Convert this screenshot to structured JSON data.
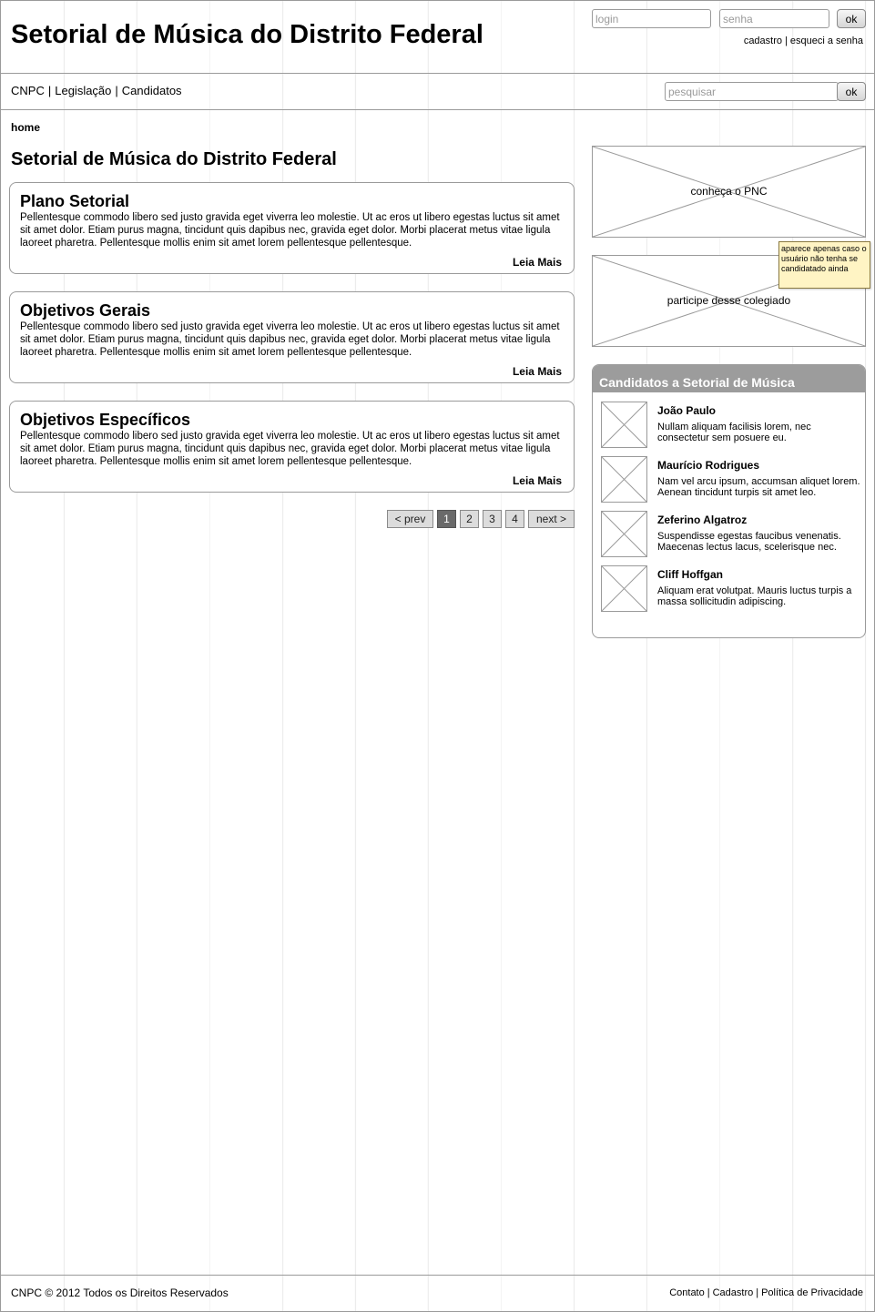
{
  "header": {
    "site_title": "Setorial de Música do Distrito Federal",
    "login_placeholder": "login",
    "password_placeholder": "senha",
    "login_button": "ok",
    "links": [
      "cadastro",
      "esqueci a senha"
    ],
    "separator": "|"
  },
  "nav": {
    "items": [
      "CNPC",
      "Legislação",
      "Candidatos"
    ],
    "separator": "|",
    "search_placeholder": "pesquisar",
    "search_button": "ok"
  },
  "breadcrumb": "home",
  "page_title": "Setorial de Música do Distrito Federal",
  "sections": [
    {
      "title": "Plano Setorial",
      "body": "Pellentesque commodo libero sed justo gravida eget viverra leo molestie. Ut ac eros ut libero egestas luctus sit amet sit amet dolor. Etiam purus magna, tincidunt quis dapibus nec, gravida eget dolor. Morbi placerat metus vitae ligula laoreet pharetra. Pellentesque mollis enim sit amet lorem pellentesque pellentesque.",
      "more": "Leia Mais"
    },
    {
      "title": "Objetivos Gerais",
      "body": "Pellentesque commodo libero sed justo gravida eget viverra leo molestie. Ut ac eros ut libero egestas luctus sit amet sit amet dolor. Etiam purus magna, tincidunt quis dapibus nec, gravida eget dolor. Morbi placerat metus vitae ligula laoreet pharetra. Pellentesque mollis enim sit amet lorem pellentesque pellentesque.",
      "more": "Leia Mais"
    },
    {
      "title": "Objetivos Específicos",
      "body": "Pellentesque commodo libero sed justo gravida eget viverra leo molestie. Ut ac eros ut libero egestas luctus sit amet sit amet dolor. Etiam purus magna, tincidunt quis dapibus nec, gravida eget dolor. Morbi placerat metus vitae ligula laoreet pharetra. Pellentesque mollis enim sit amet lorem pellentesque pellentesque.",
      "more": "Leia Mais"
    }
  ],
  "pagination": {
    "prev": "< prev",
    "pages": [
      "1",
      "2",
      "3",
      "4"
    ],
    "current_page": "1",
    "next": "next >"
  },
  "sidebar": {
    "banner_pnc": "conheça o PNC",
    "banner_join": "participe desse colegiado",
    "annotation_note": "aparece apenas caso o usuário não tenha se candidatado ainda",
    "candidates_title": "Candidatos a Setorial de Música",
    "candidates": [
      {
        "name": "João Paulo",
        "desc": "Nullam aliquam facilisis lorem, nec consectetur sem posuere eu."
      },
      {
        "name": "Maurício Rodrigues",
        "desc": "Nam vel arcu ipsum, accumsan aliquet lorem. Aenean tincidunt turpis sit amet leo."
      },
      {
        "name": "Zeferino Algatroz",
        "desc": "Suspendisse egestas faucibus venenatis. Maecenas lectus lacus, scelerisque nec."
      },
      {
        "name": "Cliff Hoffgan",
        "desc": "Aliquam erat volutpat. Mauris luctus turpis a massa sollicitudin adipiscing."
      }
    ]
  },
  "footer": {
    "copyright": "CNPC © 2012 Todos os Direitos Reservados",
    "links": [
      "Contato",
      "Cadastro",
      "Política de Privacidade"
    ],
    "separator": "|"
  }
}
